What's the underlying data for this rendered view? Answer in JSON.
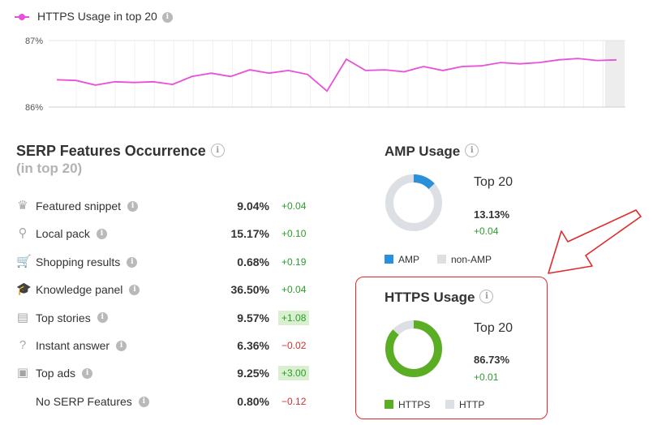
{
  "legend": {
    "label": "HTTPS Usage in top 20",
    "color": "#e94fd8",
    "icon": "info-icon"
  },
  "chart_data": {
    "type": "line",
    "series": [
      {
        "name": "HTTPS Usage in top 20",
        "values": [
          86.41,
          86.4,
          86.33,
          86.38,
          86.37,
          86.38,
          86.34,
          86.46,
          86.51,
          86.46,
          86.56,
          86.51,
          86.55,
          86.49,
          86.24,
          86.72,
          86.55,
          86.56,
          86.53,
          86.61,
          86.55,
          86.61,
          86.62,
          86.67,
          86.65,
          86.67,
          86.71,
          86.73,
          86.7,
          86.71
        ]
      }
    ],
    "yticks": [
      "87%",
      "86%"
    ],
    "ylim": [
      86,
      87
    ],
    "grid": true
  },
  "serp": {
    "title": "SERP Features Occurrence",
    "subtitle": "(in top 20)",
    "rows": [
      {
        "icon": "crown-icon",
        "glyph": "♛",
        "name": "Featured snippet",
        "value": "9.04%",
        "delta": "+0.04",
        "trend": "pos"
      },
      {
        "icon": "pin-icon",
        "glyph": "⚲",
        "name": "Local pack",
        "value": "15.17%",
        "delta": "+0.10",
        "trend": "pos"
      },
      {
        "icon": "cart-icon",
        "glyph": "🛒",
        "name": "Shopping results",
        "value": "0.68%",
        "delta": "+0.19",
        "trend": "pos"
      },
      {
        "icon": "graduation-cap-icon",
        "glyph": "🎓",
        "name": "Knowledge panel",
        "value": "36.50%",
        "delta": "+0.04",
        "trend": "pos"
      },
      {
        "icon": "newspaper-icon",
        "glyph": "▤",
        "name": "Top stories",
        "value": "9.57%",
        "delta": "+1.08",
        "trend": "pos-hl"
      },
      {
        "icon": "question-icon",
        "glyph": "?",
        "name": "Instant answer",
        "value": "6.36%",
        "delta": "−0.02",
        "trend": "neg"
      },
      {
        "icon": "ad-icon",
        "glyph": "▣",
        "name": "Top ads",
        "value": "9.25%",
        "delta": "+3.00",
        "trend": "pos-hl"
      },
      {
        "icon": "",
        "glyph": "",
        "name": "No SERP Features",
        "value": "0.80%",
        "delta": "−0.12",
        "trend": "neg"
      }
    ]
  },
  "amp": {
    "title": "AMP Usage",
    "top_label": "Top 20",
    "value": "13.13%",
    "fraction": 0.1313,
    "delta": "+0.04",
    "legend": [
      "AMP",
      "non-AMP"
    ],
    "colors": {
      "primary": "#2a90d9",
      "rest": "#dcdfe3"
    }
  },
  "https": {
    "title": "HTTPS Usage",
    "top_label": "Top 20",
    "value": "86.73%",
    "fraction": 0.8673,
    "delta": "+0.01",
    "legend": [
      "HTTPS",
      "HTTP"
    ],
    "colors": {
      "primary": "#5bae23",
      "rest": "#dcdfe3"
    }
  },
  "colors": {
    "highlight_border": "#e02a2a",
    "positive": "#2b9d2b",
    "negative": "#d23030"
  }
}
